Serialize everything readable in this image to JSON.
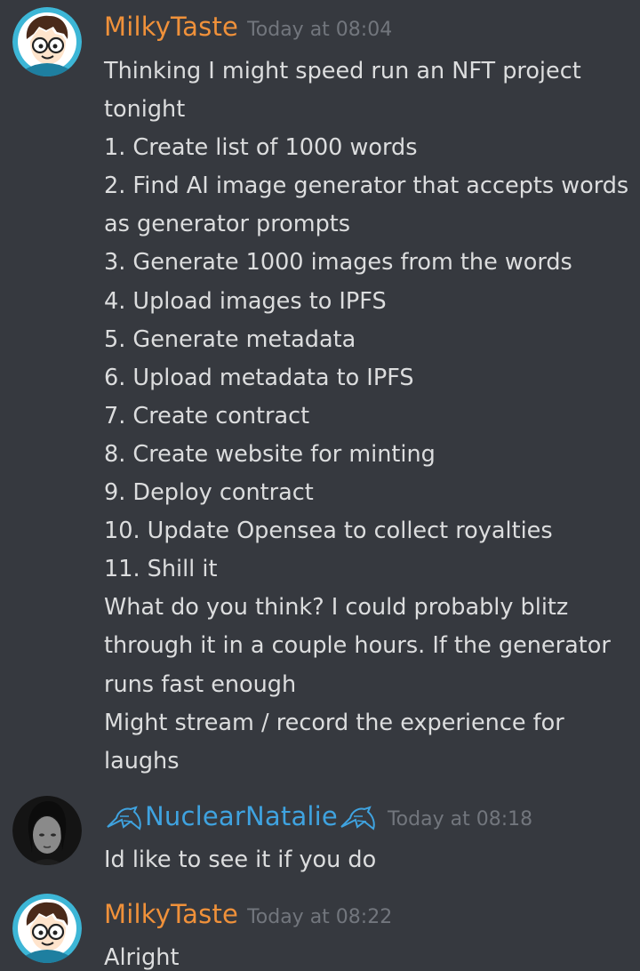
{
  "colors": {
    "background": "#36393f",
    "text": "#dcddde",
    "timestamp": "#72767d",
    "milky_name": "#f0913a",
    "natalie_name": "#3fa3e0"
  },
  "messages": [
    {
      "author": "MilkyTaste",
      "timestamp": "Today at 08:04",
      "avatar_icon": "cartoon-boy-with-glasses-avatar",
      "lines": [
        "Thinking I might speed run an NFT project",
        "tonight",
        "1. Create list of 1000 words",
        "2. Find AI image generator that accepts words",
        "as generator prompts",
        "3. Generate 1000 images from the words",
        "4. Upload images to IPFS",
        "5. Generate metadata",
        "6. Upload metadata to IPFS",
        "7. Create contract",
        "8. Create website for minting",
        "9. Deploy contract",
        "10. Update Opensea to collect royalties",
        "11. Shill it",
        "What do you think? I could probably blitz",
        "through it in a couple hours. If the generator",
        "runs fast enough",
        "Might stream / record the experience for",
        "laughs"
      ]
    },
    {
      "author": "NuclearNatalie",
      "timestamp": "Today at 08:18",
      "avatar_icon": "dark-portrait-photo-avatar",
      "name_decoration_icon": "bird-icon",
      "lines": [
        "Id like to see it if you do"
      ]
    },
    {
      "author": "MilkyTaste",
      "timestamp": "Today at 08:22",
      "avatar_icon": "cartoon-boy-with-glasses-avatar",
      "lines": [
        "Alright"
      ]
    }
  ]
}
